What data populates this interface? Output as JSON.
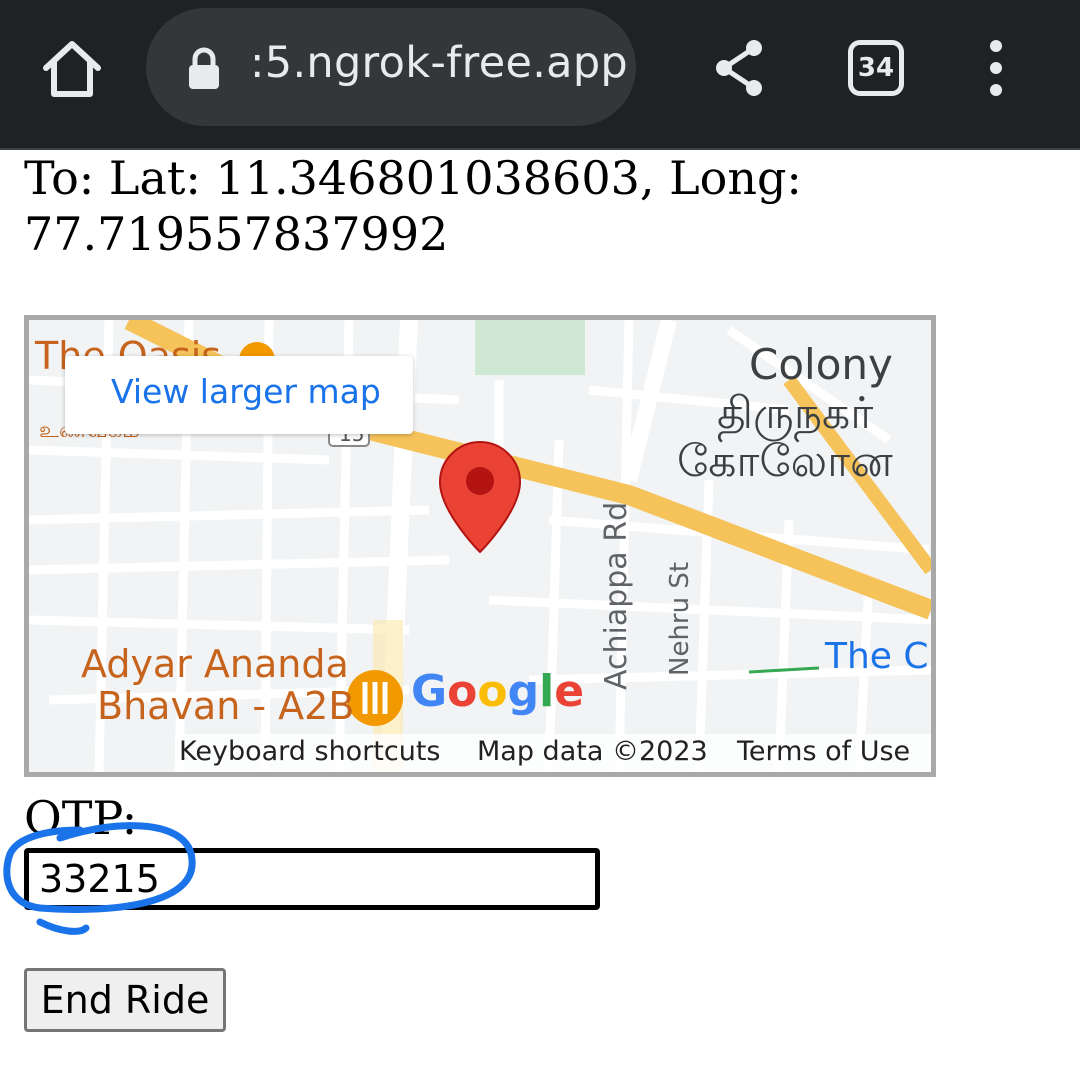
{
  "browser": {
    "url": ":5.ngrok-free.app",
    "tab_count": "34",
    "icons": [
      "home-icon",
      "lock-icon",
      "share-icon",
      "tabs-icon",
      "menu-icon"
    ]
  },
  "destination": {
    "text": "To: Lat: 11.346801038603, Long: 77.719557837992"
  },
  "map": {
    "view_larger": "View larger map",
    "labels": {
      "oasis": "The Oasis",
      "oasis_tamil": "உணவகம்",
      "colony": "Colony",
      "tamil_line1": "திருநகர்",
      "tamil_line2": "கோலோன",
      "adyar_line1": "Adyar Ananda",
      "adyar_line2": "Bhavan - A2B",
      "the_c": "The C",
      "road1": "Achiappa Rd",
      "road2": "Nehru St",
      "route_number": "15"
    },
    "google": [
      "G",
      "o",
      "o",
      "g",
      "l",
      "e"
    ],
    "footer": {
      "shortcuts": "Keyboard shortcuts",
      "data": "Map data ©2023",
      "terms": "Terms of Use"
    },
    "colors": {
      "highway": "#f6c35b",
      "pin": "#ea4335",
      "pin_dot": "#b31412",
      "park": "#c8e6c9"
    }
  },
  "form": {
    "otp_label": "OTP:",
    "otp_value": "33215",
    "end_button": "End Ride",
    "annotation_color": "#1a73e8"
  }
}
